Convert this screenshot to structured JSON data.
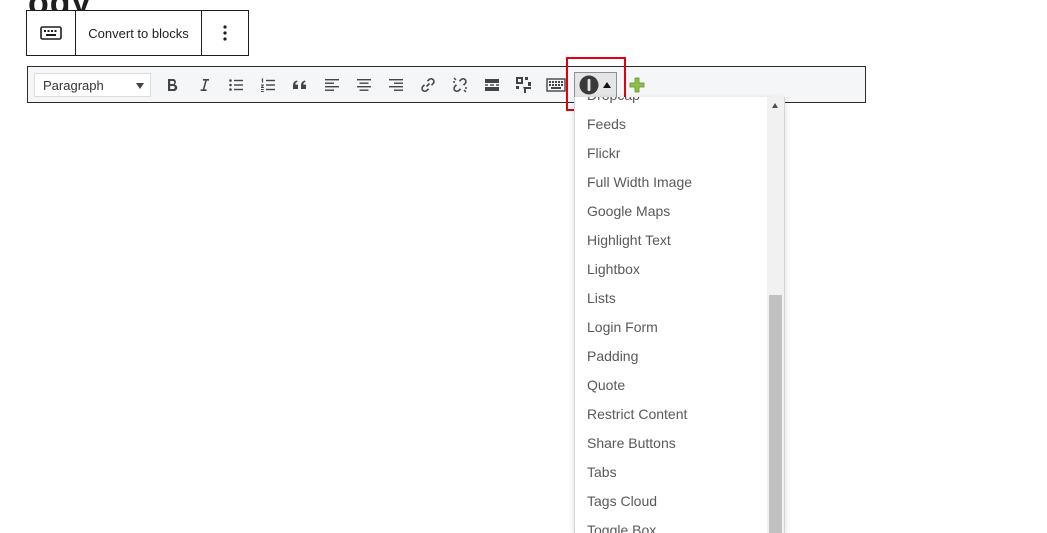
{
  "heading_fragment": "ogy",
  "block_toolbar": {
    "keyboard_icon": "keyboard-icon",
    "convert_label": "Convert to blocks",
    "more_icon": "more-vertical-icon"
  },
  "mce_toolbar": {
    "format_select_value": "Paragraph",
    "buttons": [
      "bold-icon",
      "italic-icon",
      "bulleted-list-icon",
      "numbered-list-icon",
      "blockquote-icon",
      "align-left-icon",
      "align-center-icon",
      "align-right-icon",
      "link-icon",
      "unlink-icon",
      "read-more-icon",
      "toolbar-toggle-icon",
      "keyboard-shortcuts-icon",
      "shortcodes-icon",
      "add-icon"
    ]
  },
  "dropdown": {
    "items": [
      "Dropcap",
      "Feeds",
      "Flickr",
      "Full Width Image",
      "Google Maps",
      "Highlight Text",
      "Lightbox",
      "Lists",
      "Login Form",
      "Padding",
      "Quote",
      "Restrict Content",
      "Share Buttons",
      "Tabs",
      "Tags Cloud",
      "Toggle Box"
    ]
  },
  "colors": {
    "highlight": "#e1000f",
    "toolbar_bg": "#f5f6f7",
    "item_text": "#595959",
    "add_icon": "#8bc34a"
  }
}
